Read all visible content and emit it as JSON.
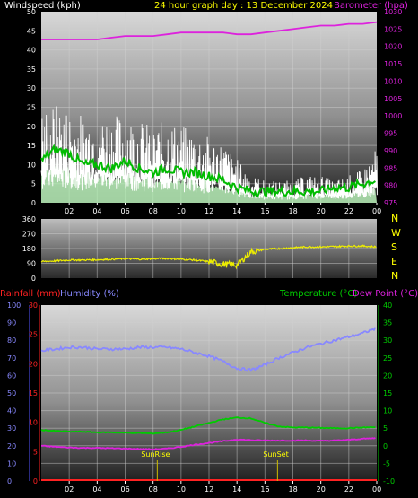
{
  "header": {
    "windspeed_label": "Windspeed (kph)",
    "title": "24 hour graph day : 13 December 2024",
    "barometer_label": "Barometer (hpa)"
  },
  "legend_bottom": {
    "rainfall_label": "Rainfall (mm)",
    "humidity_label": "Humidity (%)",
    "temperature_label": "Temperature (°C)",
    "dewpoint_label": "Dew Point (°C)"
  },
  "direction_labels": [
    "N",
    "W",
    "S",
    "E",
    "N"
  ],
  "annotations": {
    "sunrise": "SunRise",
    "sunset": "SunSet",
    "sunrise_hour": 8.3,
    "sunset_hour": 16.9
  },
  "hour_ticks": [
    "02",
    "04",
    "06",
    "08",
    "10",
    "12",
    "14",
    "16",
    "18",
    "20",
    "22",
    "00"
  ],
  "colors": {
    "windspeed": "#ffffff",
    "wind_avg": "#00bb00",
    "wind_fill": "#b8f0b8",
    "barometer": "#dd22dd",
    "direction": "#eeee00",
    "rainfall": "#ff2222",
    "humidity": "#8888ff",
    "temperature": "#00cc00",
    "dewpoint": "#dd22dd",
    "title": "#ffff00",
    "direction_text": "#ffff00"
  },
  "chart_data": [
    {
      "type": "line",
      "title": "24 hour graph day : 13 December 2024",
      "x_unit": "hour of day",
      "xlim": [
        0,
        24
      ],
      "left_axis": {
        "label": "Windspeed (kph)",
        "ylim": [
          0,
          50
        ],
        "ticks": [
          0,
          5,
          10,
          15,
          20,
          25,
          30,
          35,
          40,
          45,
          50
        ]
      },
      "right_axis": {
        "label": "Barometer (hpa)",
        "ylim": [
          975,
          1030
        ],
        "ticks": [
          975,
          980,
          985,
          990,
          995,
          1000,
          1005,
          1010,
          1015,
          1020,
          1025,
          1030
        ]
      },
      "series": [
        {
          "name": "Windspeed",
          "axis": "left",
          "x": [
            0,
            1,
            2,
            3,
            4,
            5,
            6,
            7,
            8,
            9,
            10,
            11,
            12,
            13,
            14,
            15,
            16,
            17,
            18,
            19,
            20,
            21,
            22,
            23,
            24
          ],
          "values": [
            17,
            18,
            17,
            16,
            17,
            16,
            16,
            15,
            14,
            15,
            14,
            13,
            12,
            11,
            8,
            5,
            4,
            4,
            4,
            5,
            5,
            4,
            5,
            6,
            10
          ]
        },
        {
          "name": "Average",
          "axis": "left",
          "x": [
            0,
            1,
            2,
            3,
            4,
            5,
            6,
            7,
            8,
            9,
            10,
            11,
            12,
            13,
            14,
            15,
            16,
            17,
            18,
            19,
            20,
            21,
            22,
            23,
            24
          ],
          "values": [
            11,
            14,
            13,
            10,
            10,
            9,
            11,
            9,
            8,
            9,
            8,
            8,
            7,
            6,
            4,
            3,
            3,
            3,
            3,
            3,
            3,
            4,
            4,
            5,
            6
          ]
        },
        {
          "name": "Barometer",
          "axis": "right",
          "x": [
            0,
            1,
            2,
            3,
            4,
            5,
            6,
            7,
            8,
            9,
            10,
            11,
            12,
            13,
            14,
            15,
            16,
            17,
            18,
            19,
            20,
            21,
            22,
            23,
            24
          ],
          "values": [
            1022,
            1022,
            1022,
            1022,
            1022,
            1022.5,
            1023,
            1023,
            1023,
            1023.5,
            1024,
            1024,
            1024,
            1024,
            1023.5,
            1023.5,
            1024,
            1024.5,
            1025,
            1025.5,
            1026,
            1026,
            1026.5,
            1026.5,
            1027
          ]
        }
      ]
    },
    {
      "type": "line",
      "xlim": [
        0,
        24
      ],
      "y_ticks": [
        0,
        90,
        180,
        270,
        360
      ],
      "ylim": [
        0,
        360
      ],
      "series": [
        {
          "name": "Wind Direction",
          "x": [
            0,
            1,
            2,
            3,
            4,
            5,
            6,
            7,
            8,
            9,
            10,
            11,
            12,
            13,
            14,
            15,
            16,
            17,
            18,
            19,
            20,
            21,
            22,
            23,
            24
          ],
          "values": [
            100,
            105,
            110,
            110,
            112,
            115,
            118,
            115,
            118,
            120,
            115,
            110,
            100,
            85,
            80,
            160,
            175,
            180,
            185,
            190,
            190,
            192,
            195,
            195,
            190
          ]
        }
      ]
    },
    {
      "type": "line",
      "xlim": [
        0,
        24
      ],
      "axes": {
        "rainfall": {
          "label": "Rainfall (mm)",
          "ylim": [
            0,
            30
          ],
          "ticks": [
            0,
            5,
            10,
            15,
            20,
            25,
            30
          ]
        },
        "humidity": {
          "label": "Humidity (%)",
          "ylim": [
            0,
            100
          ],
          "ticks": [
            0,
            10,
            20,
            30,
            40,
            50,
            60,
            70,
            80,
            90,
            100
          ]
        },
        "temperature": {
          "label": "Temperature (°C)",
          "ylim": [
            -10,
            40
          ],
          "ticks": [
            -10,
            -5,
            0,
            5,
            10,
            15,
            20,
            25,
            30,
            35,
            40
          ]
        }
      },
      "series": [
        {
          "name": "Humidity",
          "axis": "humidity",
          "x": [
            0,
            1,
            2,
            3,
            4,
            5,
            6,
            7,
            8,
            9,
            10,
            11,
            12,
            13,
            14,
            15,
            16,
            17,
            18,
            19,
            20,
            21,
            22,
            23,
            24
          ],
          "values": [
            74,
            75,
            76,
            76,
            75,
            75,
            75,
            76,
            76,
            76,
            75,
            73,
            71,
            68,
            64,
            63,
            66,
            70,
            73,
            76,
            78,
            80,
            82,
            84,
            87
          ]
        },
        {
          "name": "Temperature",
          "axis": "temperature",
          "x": [
            0,
            1,
            2,
            3,
            4,
            5,
            6,
            7,
            8,
            9,
            10,
            11,
            12,
            13,
            14,
            15,
            16,
            17,
            18,
            19,
            20,
            21,
            22,
            23,
            24
          ],
          "values": [
            4.5,
            4.2,
            4.0,
            4.0,
            3.8,
            3.8,
            3.7,
            3.6,
            3.5,
            3.8,
            4.5,
            5.5,
            6.5,
            7.5,
            8.0,
            7.8,
            6.5,
            5.5,
            5.2,
            5.2,
            5.1,
            5.0,
            5.0,
            5.2,
            5.3
          ]
        },
        {
          "name": "Dew Point",
          "axis": "temperature",
          "x": [
            0,
            1,
            2,
            3,
            4,
            5,
            6,
            7,
            8,
            9,
            10,
            11,
            12,
            13,
            14,
            15,
            16,
            17,
            18,
            19,
            20,
            21,
            22,
            23,
            24
          ],
          "values": [
            0,
            -0.3,
            -0.5,
            -0.6,
            -0.6,
            -0.7,
            -0.8,
            -0.9,
            -1.0,
            -0.8,
            -0.3,
            0.3,
            0.8,
            1.3,
            1.8,
            1.6,
            1.5,
            1.5,
            1.5,
            1.5,
            1.4,
            1.5,
            1.7,
            2.0,
            2.2
          ]
        },
        {
          "name": "Rainfall",
          "axis": "rainfall",
          "x": [
            0,
            24
          ],
          "values": [
            0,
            0
          ]
        }
      ]
    }
  ]
}
